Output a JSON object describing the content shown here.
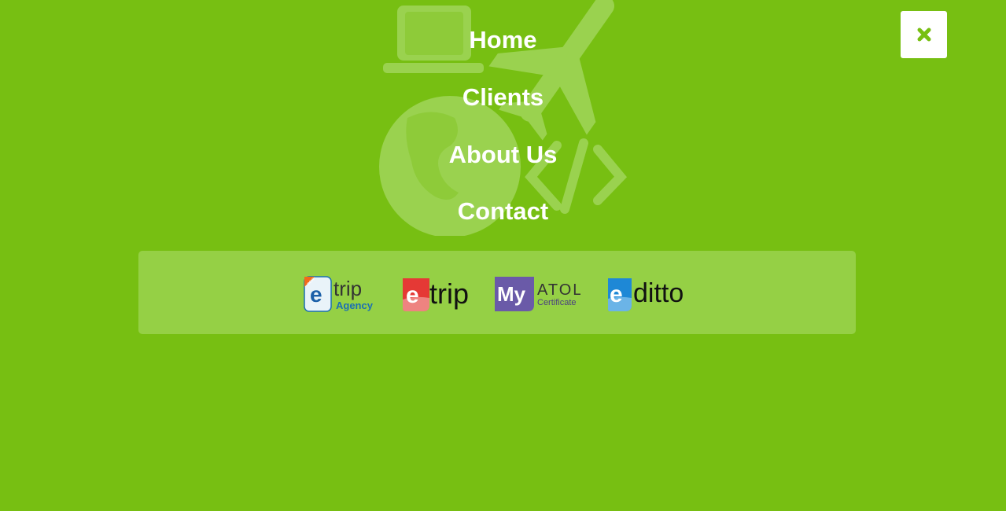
{
  "nav": {
    "items": [
      {
        "label": "Home"
      },
      {
        "label": "Clients"
      },
      {
        "label": "About Us"
      },
      {
        "label": "Contact"
      }
    ]
  },
  "close_button": {
    "icon": "close-icon",
    "glyph": "✖"
  },
  "background_icons": [
    "laptop-icon",
    "airplane-icon",
    "globe-icon",
    "code-icon"
  ],
  "logos": [
    {
      "name": "etrip-agency",
      "badge": "new",
      "letter": "e",
      "word": "trip",
      "sub": "Agency"
    },
    {
      "name": "etrip",
      "letter": "e",
      "word": "trip"
    },
    {
      "name": "myatol",
      "letter": "My",
      "word": "ATOL",
      "sub": "Certificate"
    },
    {
      "name": "editto",
      "letter": "e",
      "word": "ditto"
    }
  ],
  "colors": {
    "background": "#77bf12",
    "panel": "#95d045",
    "close_button_bg": "#ffffff",
    "close_icon": "#77bf12"
  }
}
